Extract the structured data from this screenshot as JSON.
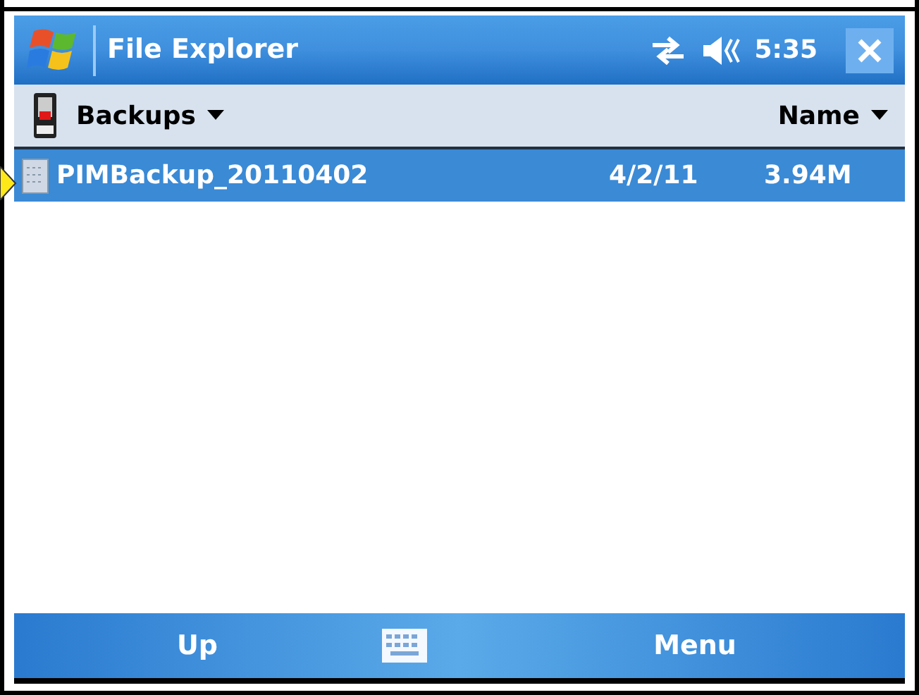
{
  "window": {
    "title": "File Explorer",
    "time": "5:35"
  },
  "location": {
    "folder": "Backups",
    "sort": "Name"
  },
  "files": [
    {
      "name": "PIMBackup_20110402",
      "date": "4/2/11",
      "size": "3.94M",
      "selected": true
    }
  ],
  "softkeys": {
    "left": "Up",
    "right": "Menu"
  }
}
